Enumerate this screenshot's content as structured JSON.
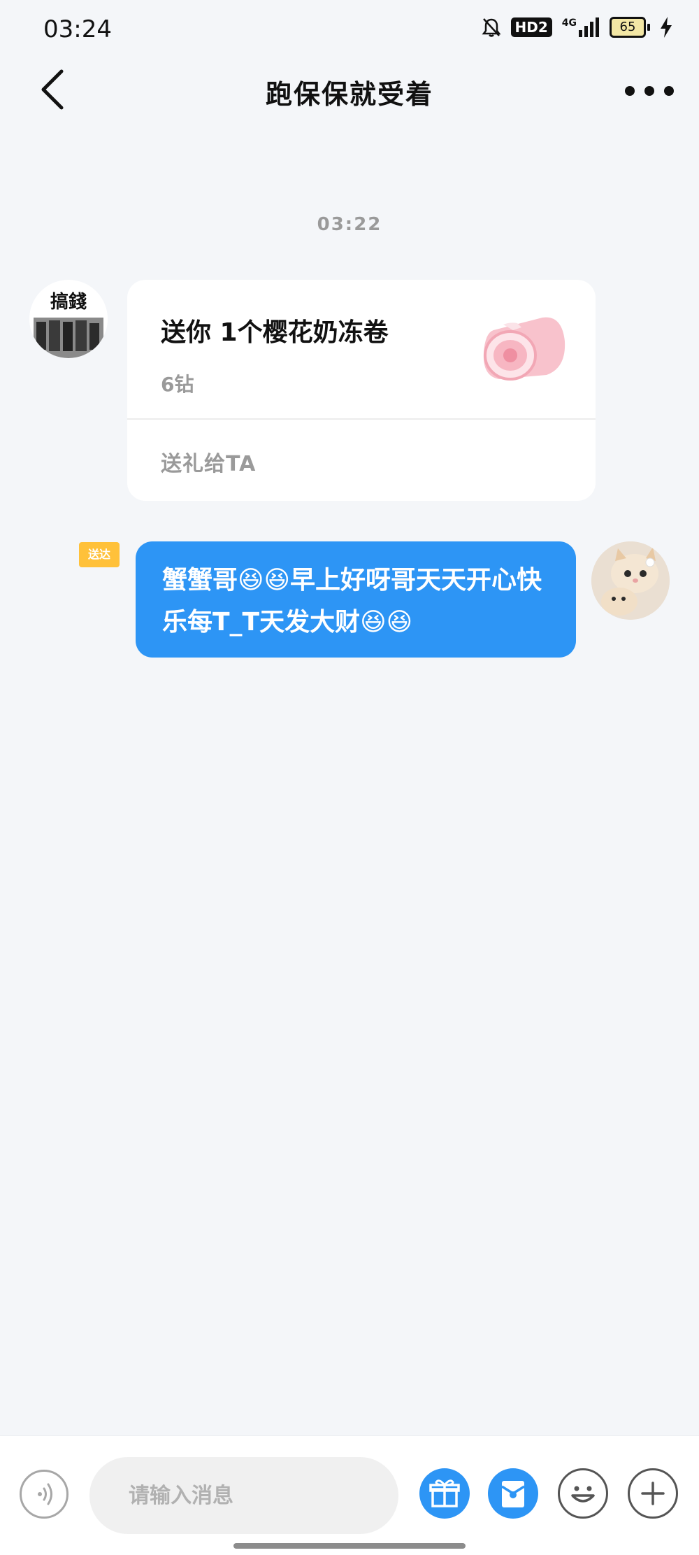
{
  "status_bar": {
    "time": "03:24",
    "hd_badge": "HD2",
    "network": "4G",
    "battery": "65",
    "icons": [
      "bell-off-icon",
      "hd-icon",
      "signal-icon",
      "battery-icon",
      "charging-icon"
    ]
  },
  "nav": {
    "title": "跑保保就受着",
    "back_icon": "chevron-left-icon",
    "more_icon": "more-dots-icon"
  },
  "chat": {
    "timestamp": "03:22",
    "gift_message": {
      "title": "送你 1个樱花奶冻卷",
      "price": "6钻",
      "action": "送礼给TA",
      "image_icon": "cake-roll-icon"
    },
    "sent_message": {
      "delivered_tag": "送达",
      "text": "蟹蟹哥😆😆早上好呀哥天天开心快乐每T_T天发大财😆😆"
    }
  },
  "input_bar": {
    "placeholder": "请输入消息",
    "voice_icon": "voice-icon",
    "gift_icon": "gift-icon",
    "red_packet_icon": "red-packet-icon",
    "emoji_icon": "emoji-icon",
    "plus_icon": "plus-icon"
  },
  "colors": {
    "accent": "#2d95f5",
    "background": "#f4f6f9",
    "delivered_tag": "#ffc13a"
  }
}
